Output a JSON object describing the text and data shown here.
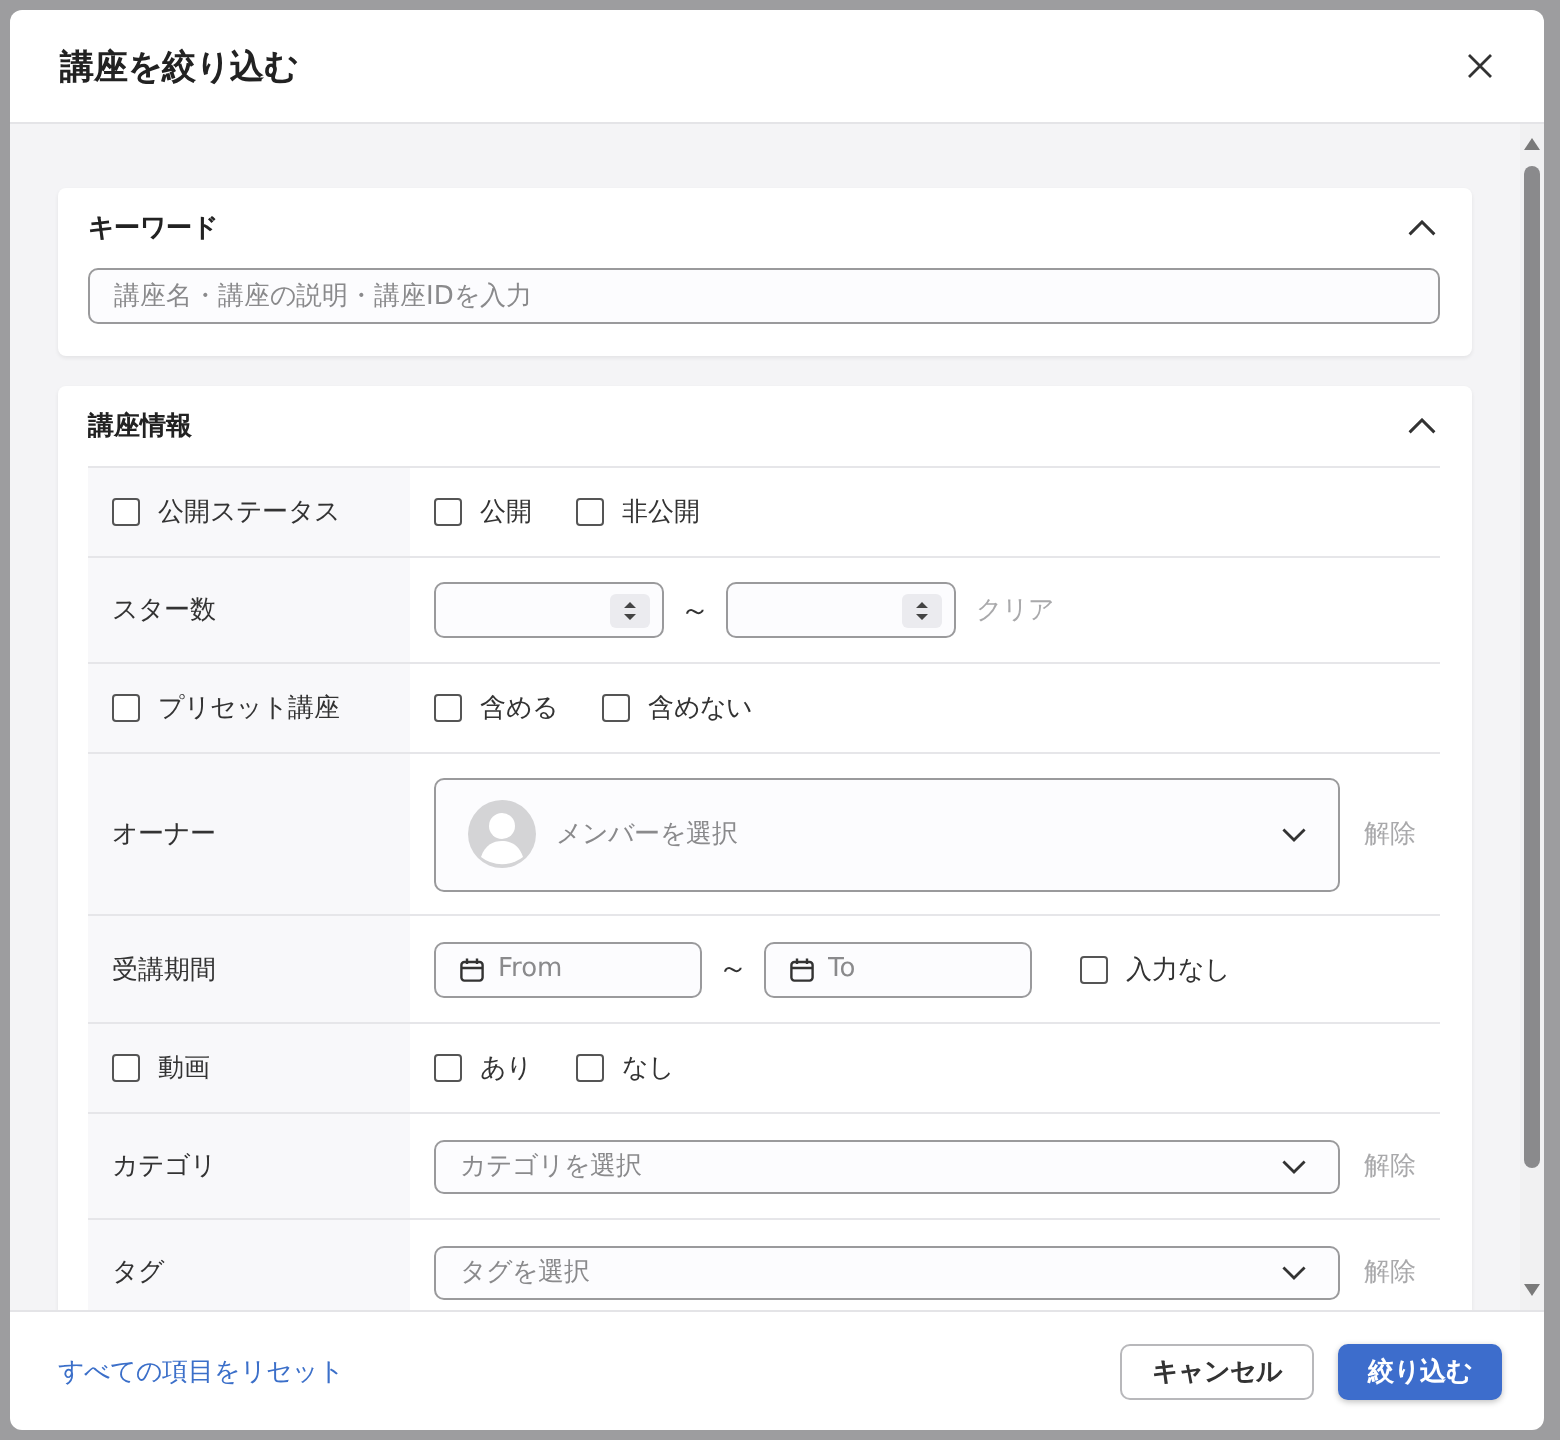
{
  "dialog": {
    "title": "講座を絞り込む"
  },
  "sections": [
    {
      "kind": "keyword",
      "title": "キーワード",
      "expanded": true,
      "placeholder": "講座名・講座の説明・講座IDを入力"
    },
    {
      "kind": "table",
      "title": "講座情報",
      "expanded": true,
      "rows": [
        {
          "kind": "options",
          "label": "公開ステータス",
          "label_checked": false,
          "options": [
            {
              "label": "公開",
              "checked": false
            },
            {
              "label": "非公開",
              "checked": false
            }
          ]
        },
        {
          "kind": "number_range",
          "label": "スター数",
          "separator": "～",
          "action": {
            "label": "クリア",
            "disabled": true
          }
        },
        {
          "kind": "options",
          "label": "プリセット講座",
          "label_checked": false,
          "options": [
            {
              "label": "含める",
              "checked": false
            },
            {
              "label": "含めない",
              "checked": false
            }
          ]
        },
        {
          "kind": "member_select",
          "label": "オーナー",
          "placeholder": "メンバーを選択",
          "action": {
            "label": "解除",
            "disabled": true
          }
        },
        {
          "kind": "date_range",
          "label": "受講期間",
          "from_placeholder": "From",
          "to_placeholder": "To",
          "separator": "～",
          "option": {
            "label": "入力なし",
            "checked": false
          }
        },
        {
          "kind": "options",
          "label": "動画",
          "label_checked": false,
          "options": [
            {
              "label": "あり",
              "checked": false
            },
            {
              "label": "なし",
              "checked": false
            }
          ]
        },
        {
          "kind": "select",
          "label": "カテゴリ",
          "placeholder": "カテゴリを選択",
          "action": {
            "label": "解除",
            "disabled": true
          }
        },
        {
          "kind": "select",
          "label": "タグ",
          "placeholder": "タグを選択",
          "action": {
            "label": "解除",
            "disabled": true
          }
        }
      ]
    }
  ],
  "footer": {
    "reset_link": "すべての項目をリセット",
    "buttons": [
      {
        "kind": "secondary",
        "label": "キャンセル"
      },
      {
        "kind": "primary",
        "label": "絞り込む"
      }
    ]
  }
}
